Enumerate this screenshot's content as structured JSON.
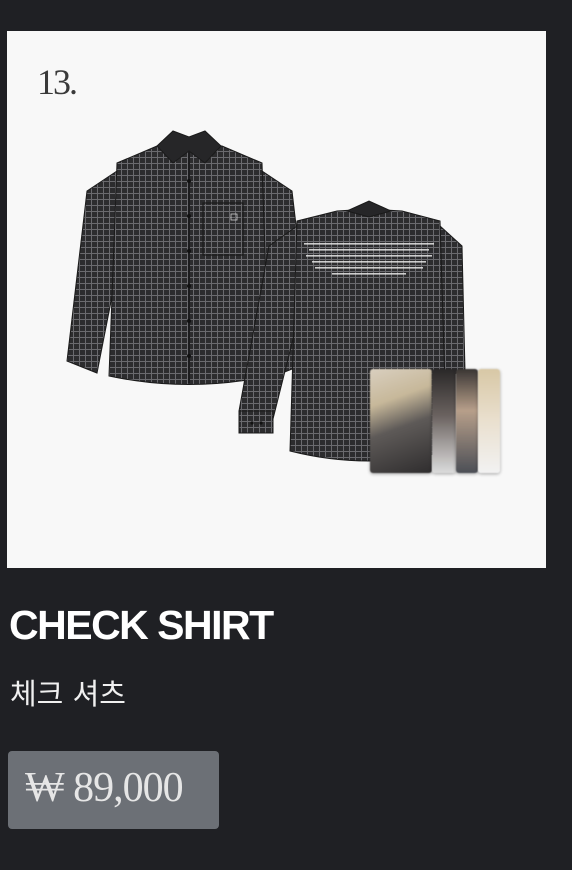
{
  "product": {
    "number": "13.",
    "name": "CHECK SHIRT",
    "name_korean": "체크 셔츠",
    "price": "₩ 89,000",
    "image_icon": "check-shirt-front-back-with-photocards"
  },
  "colors": {
    "background": "#1f2024",
    "image_bg": "#f8f8f8",
    "price_badge": "#6c7076",
    "shirt": "#2b2b2d"
  }
}
